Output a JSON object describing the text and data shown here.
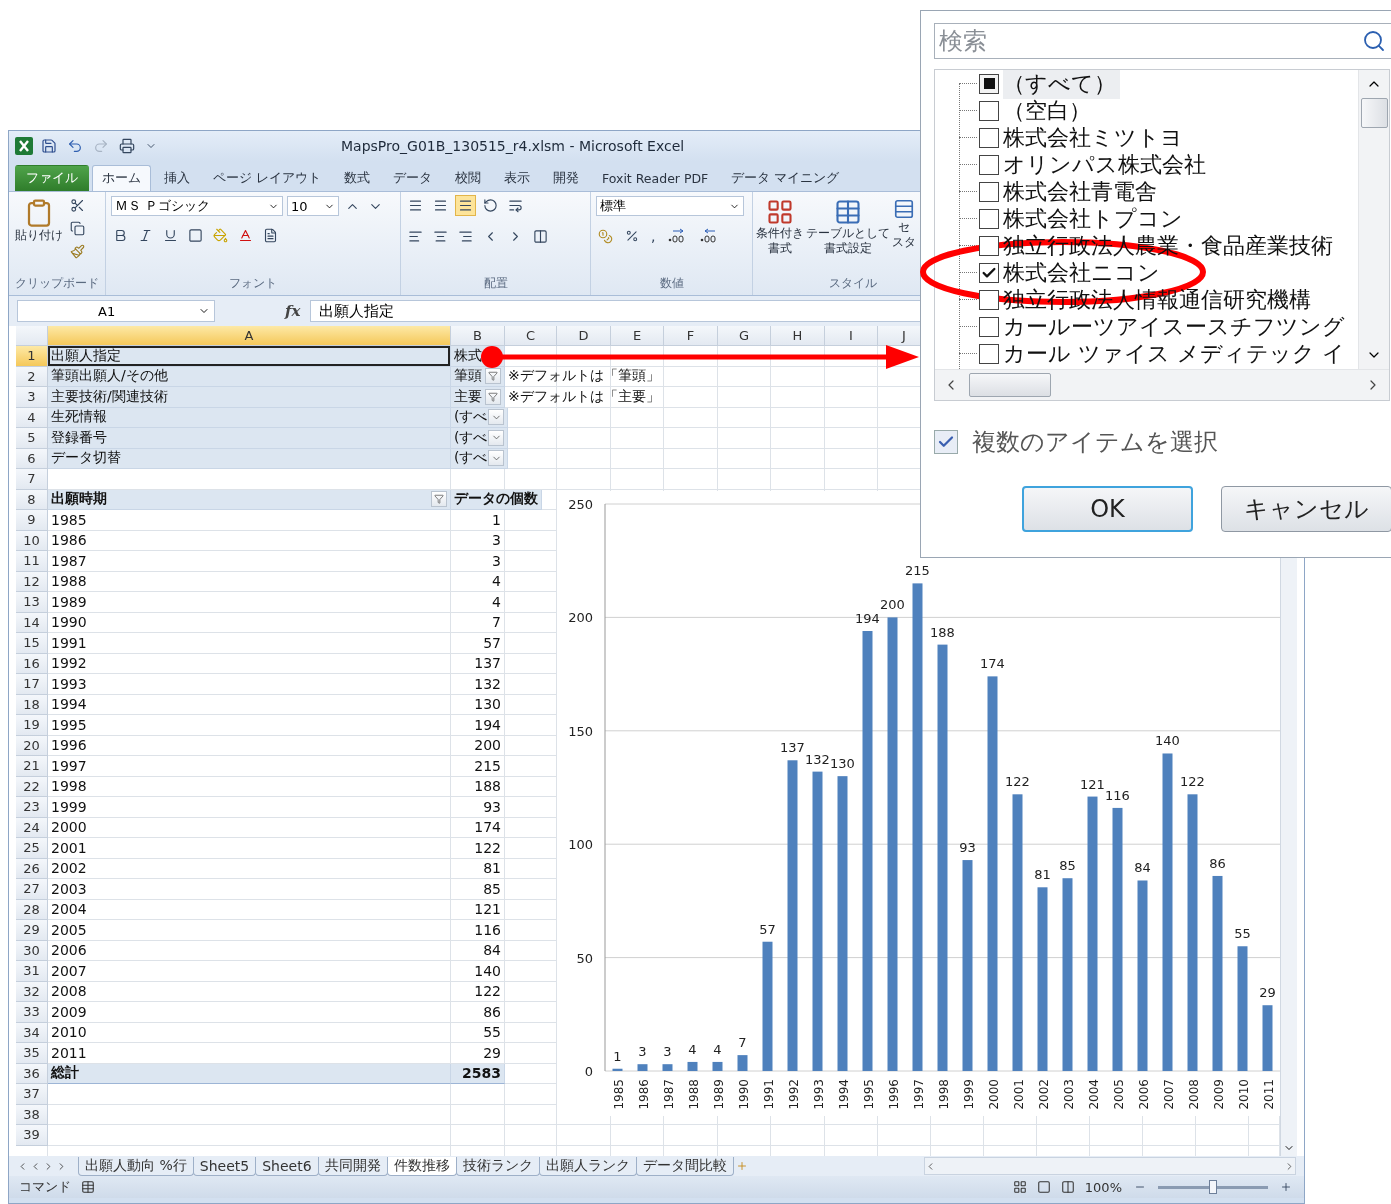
{
  "window": {
    "title": "MapsPro_G01B_130515_r4.xlsm  -  Microsoft Excel"
  },
  "ribbon_tabs": [
    {
      "label": "ファイル",
      "kind": "file",
      "selected": false
    },
    {
      "label": "ホーム",
      "kind": "tab",
      "selected": true
    },
    {
      "label": "挿入",
      "kind": "tab",
      "selected": false
    },
    {
      "label": "ページ レイアウト",
      "kind": "tab",
      "selected": false
    },
    {
      "label": "数式",
      "kind": "tab",
      "selected": false
    },
    {
      "label": "データ",
      "kind": "tab",
      "selected": false
    },
    {
      "label": "校閲",
      "kind": "tab",
      "selected": false
    },
    {
      "label": "表示",
      "kind": "tab",
      "selected": false
    },
    {
      "label": "開発",
      "kind": "tab",
      "selected": false
    },
    {
      "label": "Foxit Reader PDF",
      "kind": "tab",
      "selected": false
    },
    {
      "label": "データ マイニング",
      "kind": "tab",
      "selected": false
    }
  ],
  "ribbon": {
    "clipboard": {
      "paste": "貼り付け",
      "group": "クリップボード"
    },
    "font": {
      "name": "ＭＳ Ｐゴシック",
      "size": "10",
      "group": "フォント"
    },
    "alignment": {
      "group": "配置"
    },
    "number": {
      "format": "標準",
      "comma": ",",
      "group": "数値"
    },
    "styles": {
      "conditional": [
        "条件付き",
        "書式"
      ],
      "table": [
        "テーブルとして",
        "書式設定"
      ],
      "cell": [
        "セ",
        "スタ"
      ],
      "group": "スタイル"
    }
  },
  "formula_bar": {
    "name_box": "A1",
    "function_label": "fx",
    "content": "出願人指定"
  },
  "sheet": {
    "columns": [
      {
        "label": "A",
        "selected": true
      },
      {
        "label": "B",
        "selected": false
      },
      {
        "label": "C",
        "selected": false
      },
      {
        "label": "D",
        "selected": false
      },
      {
        "label": "E",
        "selected": false
      },
      {
        "label": "F",
        "selected": false
      },
      {
        "label": "G",
        "selected": false
      },
      {
        "label": "H",
        "selected": false
      },
      {
        "label": "I",
        "selected": false
      },
      {
        "label": "J",
        "selected": false
      }
    ],
    "rows": [
      {
        "n": "1",
        "kind": "field",
        "selected": true,
        "a": "出願人指定",
        "b": "株式"
      },
      {
        "n": "2",
        "kind": "field",
        "selected": false,
        "a": "筆頭出願人/その他",
        "b": "筆頭",
        "button": {
          "kind": "filter"
        },
        "c": "※デフォルトは「筆頭」"
      },
      {
        "n": "3",
        "kind": "field",
        "selected": false,
        "a": "主要技術/関連技術",
        "b": "主要",
        "button": {
          "kind": "filter"
        },
        "c": "※デフォルトは「主要」"
      },
      {
        "n": "4",
        "kind": "field",
        "selected": false,
        "a": "生死情報",
        "b": "(すべ",
        "button": {
          "kind": "dropdown"
        }
      },
      {
        "n": "5",
        "kind": "field",
        "selected": false,
        "a": "登録番号",
        "b": "(すべ",
        "button": {
          "kind": "dropdown"
        }
      },
      {
        "n": "6",
        "kind": "field",
        "selected": false,
        "a": "データ切替",
        "b": "(すべ",
        "button": {
          "kind": "dropdown"
        }
      },
      {
        "n": "7",
        "kind": "blank",
        "selected": false
      },
      {
        "n": "8",
        "kind": "header",
        "selected": false,
        "a": "出願時期",
        "b": "データの個数",
        "button": {
          "kind": "filter"
        }
      },
      {
        "n": "9",
        "kind": "data",
        "selected": false,
        "a": "1985",
        "b": "1"
      },
      {
        "n": "10",
        "kind": "data",
        "selected": false,
        "a": "1986",
        "b": "3"
      },
      {
        "n": "11",
        "kind": "data",
        "selected": false,
        "a": "1987",
        "b": "3"
      },
      {
        "n": "12",
        "kind": "data",
        "selected": false,
        "a": "1988",
        "b": "4"
      },
      {
        "n": "13",
        "kind": "data",
        "selected": false,
        "a": "1989",
        "b": "4"
      },
      {
        "n": "14",
        "kind": "data",
        "selected": false,
        "a": "1990",
        "b": "7"
      },
      {
        "n": "15",
        "kind": "data",
        "selected": false,
        "a": "1991",
        "b": "57"
      },
      {
        "n": "16",
        "kind": "data",
        "selected": false,
        "a": "1992",
        "b": "137"
      },
      {
        "n": "17",
        "kind": "data",
        "selected": false,
        "a": "1993",
        "b": "132"
      },
      {
        "n": "18",
        "kind": "data",
        "selected": false,
        "a": "1994",
        "b": "130"
      },
      {
        "n": "19",
        "kind": "data",
        "selected": false,
        "a": "1995",
        "b": "194"
      },
      {
        "n": "20",
        "kind": "data",
        "selected": false,
        "a": "1996",
        "b": "200"
      },
      {
        "n": "21",
        "kind": "data",
        "selected": false,
        "a": "1997",
        "b": "215"
      },
      {
        "n": "22",
        "kind": "data",
        "selected": false,
        "a": "1998",
        "b": "188"
      },
      {
        "n": "23",
        "kind": "data",
        "selected": false,
        "a": "1999",
        "b": "93"
      },
      {
        "n": "24",
        "kind": "data",
        "selected": false,
        "a": "2000",
        "b": "174"
      },
      {
        "n": "25",
        "kind": "data",
        "selected": false,
        "a": "2001",
        "b": "122"
      },
      {
        "n": "26",
        "kind": "data",
        "selected": false,
        "a": "2002",
        "b": "81"
      },
      {
        "n": "27",
        "kind": "data",
        "selected": false,
        "a": "2003",
        "b": "85"
      },
      {
        "n": "28",
        "kind": "data",
        "selected": false,
        "a": "2004",
        "b": "121"
      },
      {
        "n": "29",
        "kind": "data",
        "selected": false,
        "a": "2005",
        "b": "116"
      },
      {
        "n": "30",
        "kind": "data",
        "selected": false,
        "a": "2006",
        "b": "84"
      },
      {
        "n": "31",
        "kind": "data",
        "selected": false,
        "a": "2007",
        "b": "140"
      },
      {
        "n": "32",
        "kind": "data",
        "selected": false,
        "a": "2008",
        "b": "122"
      },
      {
        "n": "33",
        "kind": "data",
        "selected": false,
        "a": "2009",
        "b": "86"
      },
      {
        "n": "34",
        "kind": "data",
        "selected": false,
        "a": "2010",
        "b": "55"
      },
      {
        "n": "35",
        "kind": "data",
        "selected": false,
        "a": "2011",
        "b": "29"
      },
      {
        "n": "36",
        "kind": "total",
        "selected": false,
        "a": "総計",
        "b": "2583"
      },
      {
        "n": "37",
        "kind": "blank",
        "selected": false
      },
      {
        "n": "38",
        "kind": "blank",
        "selected": false
      },
      {
        "n": "39",
        "kind": "blank",
        "selected": false
      }
    ],
    "chart_data": {
      "type": "bar",
      "categories": [
        "1985",
        "1986",
        "1987",
        "1988",
        "1989",
        "1990",
        "1991",
        "1992",
        "1993",
        "1994",
        "1995",
        "1996",
        "1997",
        "1998",
        "1999",
        "2000",
        "2001",
        "2002",
        "2003",
        "2004",
        "2005",
        "2006",
        "2007",
        "2008",
        "2009",
        "2010",
        "2011"
      ],
      "values": [
        1,
        3,
        3,
        4,
        4,
        7,
        57,
        137,
        132,
        130,
        194,
        200,
        215,
        188,
        93,
        174,
        122,
        81,
        85,
        121,
        116,
        84,
        140,
        122,
        86,
        55,
        29
      ],
      "ylim": [
        0,
        250
      ],
      "yticks": [
        0,
        50,
        100,
        150,
        200,
        250
      ],
      "grid": true,
      "data_labels": true
    }
  },
  "sheet_tabs": [
    {
      "label": "出願人動向 %行",
      "selected": false
    },
    {
      "label": "Sheet5",
      "selected": false
    },
    {
      "label": "Sheet6",
      "selected": false
    },
    {
      "label": "共同開発",
      "selected": false
    },
    {
      "label": "件数推移",
      "selected": true
    },
    {
      "label": "技術ランク",
      "selected": false
    },
    {
      "label": "出願人ランク",
      "selected": false
    },
    {
      "label": "データ間比較",
      "selected": false
    }
  ],
  "status_bar": {
    "mode": "コマンド",
    "zoom": {
      "label": "100%",
      "level": 0.5
    }
  },
  "filter_dialog": {
    "search": {
      "placeholder": "検索"
    },
    "items": [
      {
        "label": "（すべて）",
        "checked": false,
        "indeterminate": true
      },
      {
        "label": "（空白）",
        "checked": false,
        "indeterminate": false
      },
      {
        "label": "株式会社ミツトヨ",
        "checked": false,
        "indeterminate": false
      },
      {
        "label": "オリンパス株式会社",
        "checked": false,
        "indeterminate": false
      },
      {
        "label": "株式会社青電舎",
        "checked": false,
        "indeterminate": false
      },
      {
        "label": "株式会社トプコン",
        "checked": false,
        "indeterminate": false
      },
      {
        "label": "独立行政法人農業・食品産業技術",
        "checked": false,
        "indeterminate": false
      },
      {
        "label": "株式会社ニコン",
        "checked": true,
        "indeterminate": false
      },
      {
        "label": "独立行政法人情報通信研究機構",
        "checked": false,
        "indeterminate": false
      },
      {
        "label": "カールーツアイスースチフツング",
        "checked": false,
        "indeterminate": false
      },
      {
        "label": "カール ツァイス メディテック イ",
        "checked": false,
        "indeterminate": false
      }
    ],
    "multi_select": {
      "label": "複数のアイテムを選択",
      "checked": true
    },
    "buttons": [
      {
        "label": "OK",
        "focused": true
      },
      {
        "label": "キャンセル",
        "focused": false
      }
    ]
  }
}
